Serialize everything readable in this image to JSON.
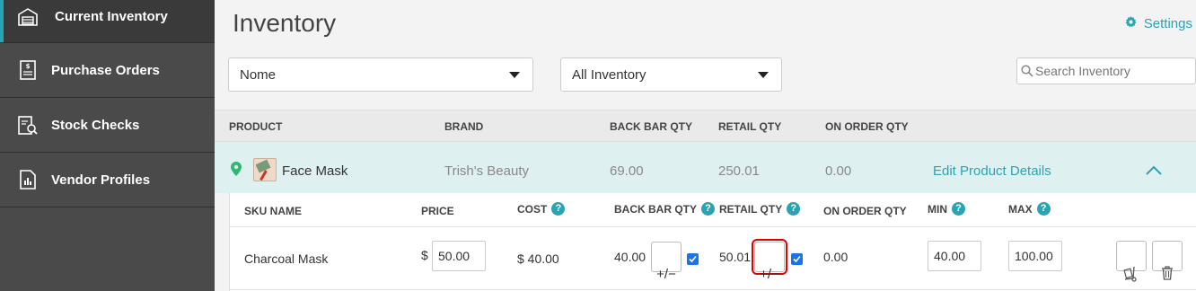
{
  "sidebar": {
    "items": [
      {
        "label": "Current Inventory",
        "icon": "warehouse-icon"
      },
      {
        "label": "Purchase Orders",
        "icon": "invoice-icon"
      },
      {
        "label": "Stock Checks",
        "icon": "clipboard-search-icon"
      },
      {
        "label": "Vendor Profiles",
        "icon": "vendor-profile-icon"
      }
    ],
    "active_color": "#2aa3b3"
  },
  "header": {
    "title": "Inventory",
    "settings_label": "Settings"
  },
  "filters": {
    "brand_select": "Nome",
    "inventory_select": "All Inventory",
    "search_placeholder": "Search Inventory"
  },
  "table": {
    "columns": [
      "PRODUCT",
      "BRAND",
      "BACK BAR QTY",
      "RETAIL QTY",
      "ON ORDER QTY"
    ],
    "product": {
      "name": "Face Mask",
      "brand": "Trish's Beauty",
      "back_bar_qty": "69.00",
      "retail_qty": "250.01",
      "on_order_qty": "0.00",
      "edit_label": "Edit Product Details"
    }
  },
  "sku_table": {
    "columns": {
      "sku_name": "SKU NAME",
      "price": "PRICE",
      "cost": "COST",
      "back_bar_qty": "BACK BAR QTY",
      "retail_qty": "RETAIL QTY",
      "on_order_qty": "ON ORDER QTY",
      "min": "MIN",
      "max": "MAX"
    },
    "help_glyph": "?",
    "row": {
      "sku_name": "Charcoal Mask",
      "currency": "$",
      "price": "50.00",
      "cost": "$ 40.00",
      "back_bar_qty": "40.00",
      "retail_qty": "50.01",
      "on_order_qty": "0.00",
      "min": "40.00",
      "max": "100.00",
      "adjust_glyph": "+/−"
    }
  },
  "colors": {
    "accent": "#2aa3b3",
    "highlight": "#e00000",
    "sidebar_bg": "#4a4a4a",
    "product_row_bg": "#dff0f1"
  }
}
